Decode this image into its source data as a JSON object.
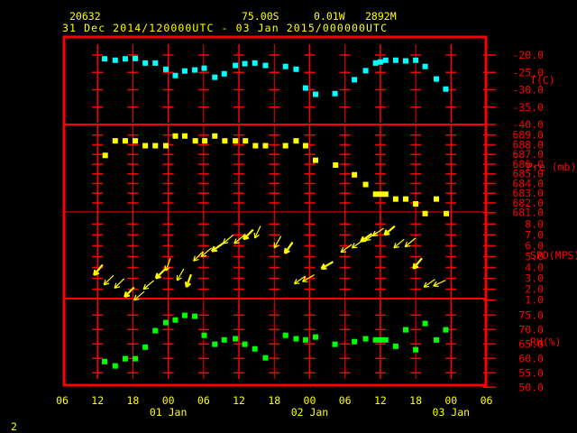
{
  "header": {
    "station": "20632",
    "lat": "75.00S",
    "lon": "0.01W",
    "elev": "2892M",
    "period": "31 Dec 2014/120000UTC - 03 Jan 2015/000000UTC"
  },
  "page_number": "2",
  "colors": {
    "frame": "#ff0000",
    "text": "#ffff00",
    "temp": "#00ffff",
    "pres": "#ffff00",
    "wind": "#ffff00",
    "rh": "#00ff00"
  },
  "chart_data": {
    "type": "scatter",
    "x_unit": "hours since 31 Dec 2014 06 UTC",
    "x_range": [
      0,
      72
    ],
    "x_ticks": [
      "06",
      "12",
      "18",
      "00",
      "06",
      "12",
      "18",
      "00",
      "06",
      "12",
      "18",
      "00",
      "06"
    ],
    "date_labels": [
      {
        "label": "01 Jan",
        "at_hour": 18
      },
      {
        "label": "02 Jan",
        "at_hour": 42
      },
      {
        "label": "03 Jan",
        "at_hour": 66
      }
    ],
    "panels": [
      {
        "name": "temperature",
        "ylabel": "T(C)",
        "ylim": [
          -40,
          -20
        ],
        "yticks": [
          "-20.0",
          "-25.0",
          "-30.0",
          "-35.0",
          "-40.0"
        ],
        "ytick_values": [
          -20,
          -25,
          -30,
          -35,
          -40
        ],
        "x": [
          7.2,
          9.0,
          10.7,
          12.4,
          14.1,
          15.8,
          17.6,
          19.2,
          20.8,
          22.5,
          24.1,
          25.9,
          27.5,
          29.4,
          31.0,
          32.7,
          34.5,
          37.9,
          39.7,
          41.3,
          43.0,
          46.3,
          49.6,
          51.5,
          53.2,
          54.0,
          54.9,
          56.6,
          58.3,
          60.0,
          61.6,
          63.5,
          65.1
        ],
        "y": [
          -21.1,
          -21.5,
          -21.1,
          -21.0,
          -22.3,
          -22.3,
          -24.1,
          -25.9,
          -24.6,
          -24.3,
          -23.8,
          -26.4,
          -25.4,
          -23.0,
          -22.5,
          -22.3,
          -23.0,
          -23.3,
          -24.1,
          -29.5,
          -31.3,
          -31.1,
          -27.1,
          -24.5,
          -22.3,
          -22.0,
          -21.5,
          -21.5,
          -21.7,
          -21.5,
          -23.3,
          -26.9,
          -29.8
        ]
      },
      {
        "name": "pressure",
        "ylabel": "Pre (mb)",
        "ylim": [
          681,
          690
        ],
        "yticks": [
          "689.0",
          "688.0",
          "687.0",
          "686.0",
          "685.0",
          "684.0",
          "683.0",
          "682.0",
          "681.0"
        ],
        "ytick_values": [
          689,
          688,
          687,
          686,
          685,
          684,
          683,
          682,
          681
        ],
        "x": [
          7.3,
          9.0,
          10.7,
          12.4,
          14.1,
          15.8,
          17.6,
          19.2,
          20.8,
          22.6,
          24.2,
          25.9,
          27.6,
          29.4,
          31.1,
          32.8,
          34.5,
          37.9,
          39.7,
          41.3,
          43.0,
          46.4,
          49.6,
          51.5,
          53.2,
          54.0,
          54.9,
          56.6,
          58.3,
          60.0,
          61.6,
          63.5,
          65.2
        ],
        "y": [
          686.9,
          688.4,
          688.4,
          688.4,
          687.9,
          687.9,
          687.9,
          688.9,
          688.9,
          688.4,
          688.4,
          688.9,
          688.4,
          688.4,
          688.4,
          687.9,
          687.9,
          687.9,
          688.4,
          687.9,
          686.4,
          685.9,
          684.9,
          683.9,
          682.9,
          682.9,
          682.9,
          682.4,
          682.4,
          681.9,
          680.9,
          682.4,
          680.9
        ]
      },
      {
        "name": "wind",
        "ylabel": "SPD(MPS)",
        "ylim": [
          1,
          9
        ],
        "yticks": [
          "8.0",
          "7.0",
          "6.0",
          "5.0",
          "4.0",
          "3.0",
          "2.0",
          "1.0"
        ],
        "ytick_values": [
          8,
          7,
          6,
          5,
          4,
          3,
          2,
          1
        ],
        "x": [
          6.0,
          7.7,
          9.5,
          11.2,
          12.8,
          14.4,
          16.5,
          18.2,
          20.1,
          21.7,
          22.9,
          24.2,
          26.0,
          27.9,
          29.8,
          31.4,
          33.3,
          36.6,
          38.4,
          40.0,
          41.4,
          44.6,
          47.9,
          49.8,
          51.3,
          52.1,
          53.3,
          55.3,
          56.9,
          58.8,
          60.2,
          62.0,
          63.6
        ],
        "y": [
          3.3,
          2.4,
          2.1,
          1.3,
          1.0,
          2.0,
          3.0,
          3.7,
          2.8,
          2.2,
          4.6,
          5.0,
          5.5,
          6.2,
          6.2,
          6.6,
          6.7,
          5.8,
          5.3,
          2.5,
          2.7,
          3.9,
          5.4,
          5.8,
          6.4,
          6.5,
          6.9,
          7.0,
          5.8,
          5.9,
          3.9,
          2.2,
          2.3
        ],
        "direction_deg": [
          40,
          45,
          45,
          45,
          50,
          50,
          45,
          20,
          30,
          20,
          45,
          50,
          55,
          50,
          50,
          45,
          25,
          30,
          35,
          55,
          60,
          60,
          55,
          55,
          55,
          55,
          55,
          50,
          50,
          50,
          40,
          55,
          65
        ]
      },
      {
        "name": "humidity",
        "ylabel": "RH(%)",
        "ylim": [
          50,
          80
        ],
        "yticks": [
          "75.0",
          "70.0",
          "65.0",
          "60.0",
          "55.0",
          "50.0"
        ],
        "ytick_values": [
          75,
          70,
          65,
          60,
          55,
          50
        ],
        "x": [
          7.2,
          9.0,
          10.7,
          12.4,
          14.1,
          15.8,
          17.6,
          19.2,
          20.8,
          22.5,
          24.1,
          25.9,
          27.5,
          29.4,
          31.0,
          32.7,
          34.5,
          37.9,
          39.7,
          41.3,
          43.0,
          46.3,
          49.6,
          51.5,
          53.2,
          54.0,
          54.9,
          56.6,
          58.3,
          60.0,
          61.6,
          63.5,
          65.1
        ],
        "y": [
          58.9,
          57.4,
          59.9,
          59.9,
          63.9,
          69.6,
          72.4,
          73.3,
          74.9,
          74.6,
          68.0,
          64.9,
          66.4,
          66.8,
          64.9,
          63.3,
          60.2,
          68.0,
          66.8,
          66.4,
          67.4,
          64.9,
          65.8,
          66.8,
          66.4,
          66.4,
          66.4,
          64.2,
          69.9,
          63.0,
          72.1,
          66.4,
          69.9
        ]
      }
    ]
  }
}
